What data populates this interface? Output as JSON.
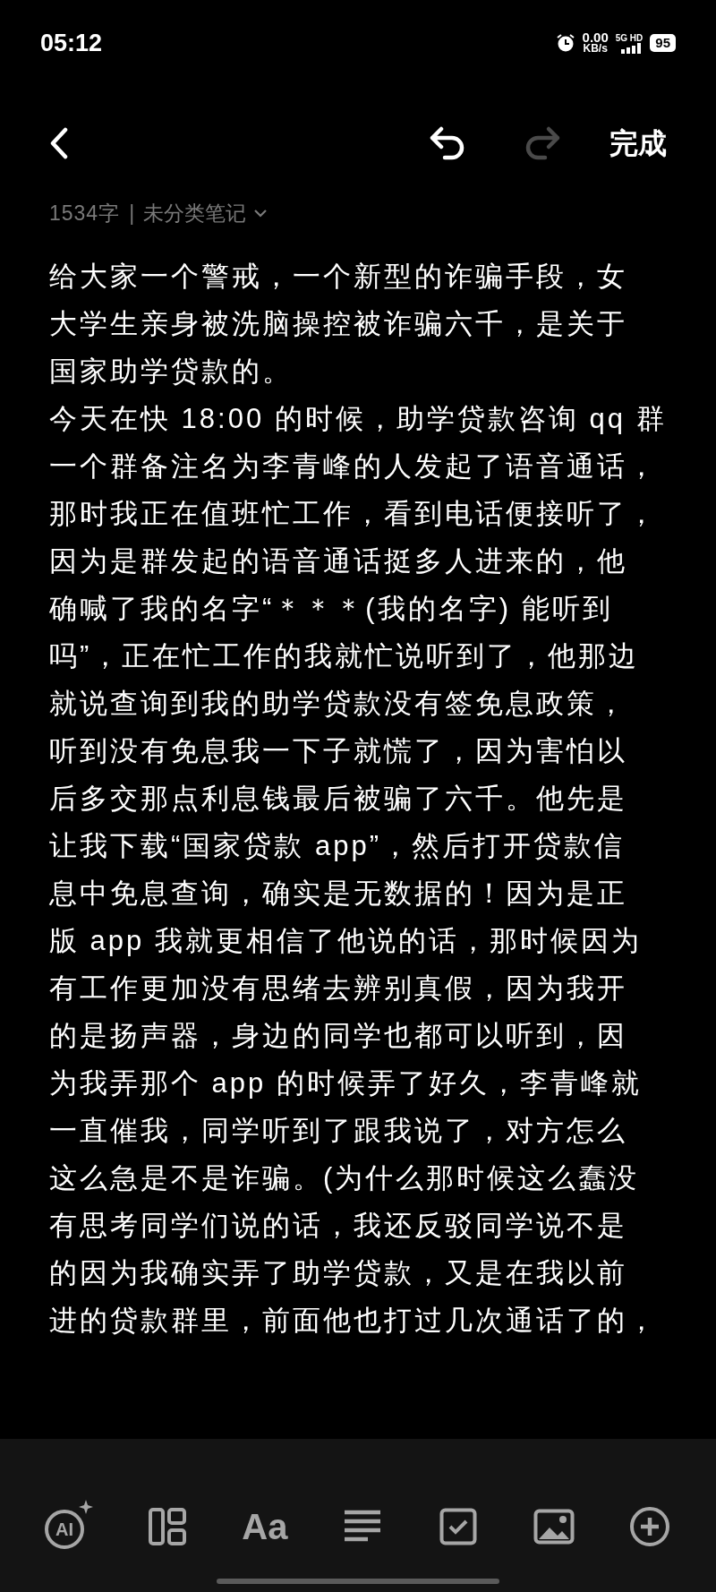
{
  "status_bar": {
    "time": "05:12",
    "speed_value": "0.00",
    "speed_unit": "KB/s",
    "network": "5G HD",
    "battery": "95"
  },
  "header": {
    "undo": {
      "disabled": false
    },
    "redo": {
      "disabled": true
    },
    "done": "完成"
  },
  "meta": {
    "word_count": "1534字",
    "separator": "|",
    "category": "未分类笔记"
  },
  "body": [
    {
      "lines": [
        "给大家一个警戒，一个新型的诈骗手段，女",
        "大学生亲身被洗脑操控被诈骗六千，是关于",
        "国家助学贷款的。"
      ]
    },
    {
      "lines": [
        "今天在快 18:00 的时候，助学贷款咨询 qq 群",
        "一个群备注名为李青峰的人发起了语音通话，",
        "那时我正在值班忙工作，看到电话便接听了，",
        "因为是群发起的语音通话挺多人进来的，他",
        "确喊了我的名字“＊＊＊(我的名字) 能听到",
        "吗”，正在忙工作的我就忙说听到了，他那边",
        "就说查询到我的助学贷款没有签免息政策，",
        "听到没有免息我一下子就慌了，因为害怕以",
        "后多交那点利息钱最后被骗了六千。他先是",
        "让我下载“国家贷款 app”，然后打开贷款信",
        "息中免息查询，确实是无数据的！因为是正",
        "版 app 我就更相信了他说的话，那时候因为",
        "有工作更加没有思绪去辨别真假，因为我开",
        "的是扬声器，身边的同学也都可以听到，因",
        "为我弄那个 app 的时候弄了好久，李青峰就",
        "一直催我，同学听到了跟我说了，对方怎么",
        "这么急是不是诈骗。(为什么那时候这么蠢没",
        "有思考同学们说的话，我还反驳同学说不是",
        "的因为我确实弄了助学贷款，又是在我以前",
        "进的贷款群里，前面他也打过几次通话了的，"
      ]
    }
  ],
  "bottom_toolbar": [
    {
      "kind": "ai",
      "label": "AI"
    },
    {
      "kind": "layout"
    },
    {
      "kind": "font",
      "label": "Aa"
    },
    {
      "kind": "align"
    },
    {
      "kind": "checkbox"
    },
    {
      "kind": "image"
    },
    {
      "kind": "add"
    }
  ]
}
